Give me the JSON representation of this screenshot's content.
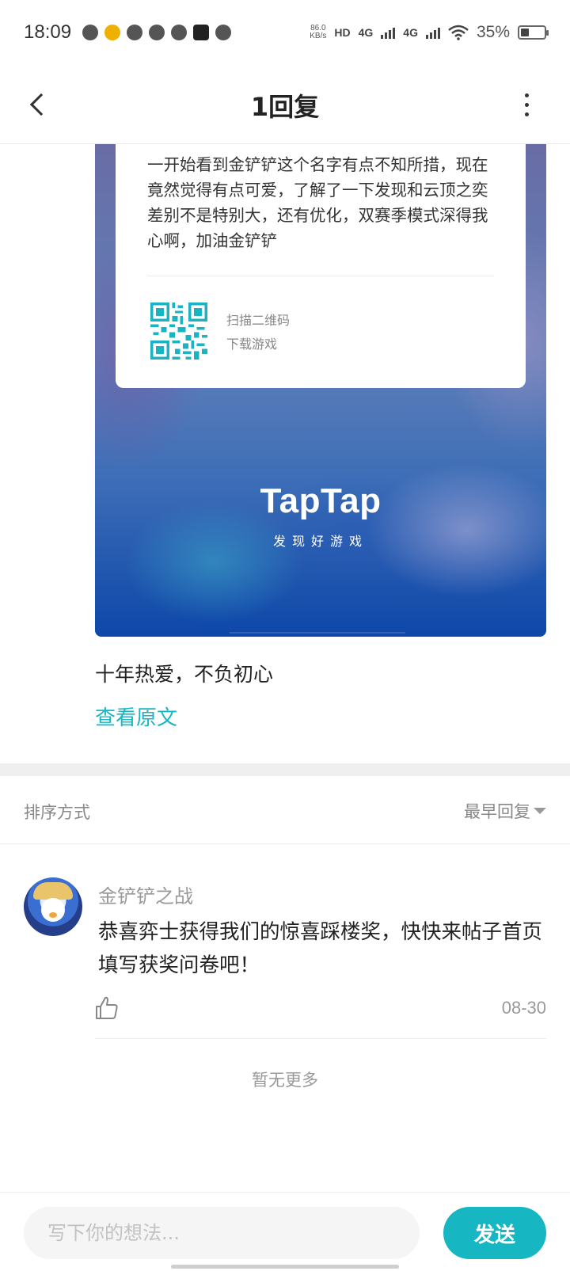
{
  "status_bar": {
    "time": "18:09",
    "net_speed_value": "86.0",
    "net_speed_unit": "KB/s",
    "hd_label": "HD",
    "signal_1": "4G",
    "signal_2": "4G",
    "battery_percent": "35%"
  },
  "header": {
    "title": "1回复",
    "back_icon": "chevron-left-icon",
    "more_icon": "more-vertical-icon"
  },
  "share_card": {
    "review_text": "一开始看到金铲铲这个名字有点不知所措，现在竟然觉得有点可爱，了解了一下发现和云顶之奕差别不是特别大，还有优化，双赛季模式深得我心啊，加油金铲铲",
    "qr_line1": "扫描二维码",
    "qr_line2": "下载游戏",
    "brand": "TapTap",
    "slogan": "发现好游戏"
  },
  "post": {
    "text": "十年热爱，不负初心",
    "view_original": "查看原文"
  },
  "sort": {
    "label": "排序方式",
    "value": "最早回复"
  },
  "replies": [
    {
      "author": "金铲铲之战",
      "text": "恭喜弈士获得我们的惊喜踩楼奖，快快来帖子首页填写获奖问卷吧！",
      "date": "08-30"
    }
  ],
  "no_more": "暂无更多",
  "composer": {
    "placeholder": "写下你的想法...",
    "send_label": "发送"
  },
  "colors": {
    "accent": "#16b6c3",
    "text_primary": "#222222",
    "text_secondary": "#999999",
    "banner_bottom": "#0d47a9"
  }
}
